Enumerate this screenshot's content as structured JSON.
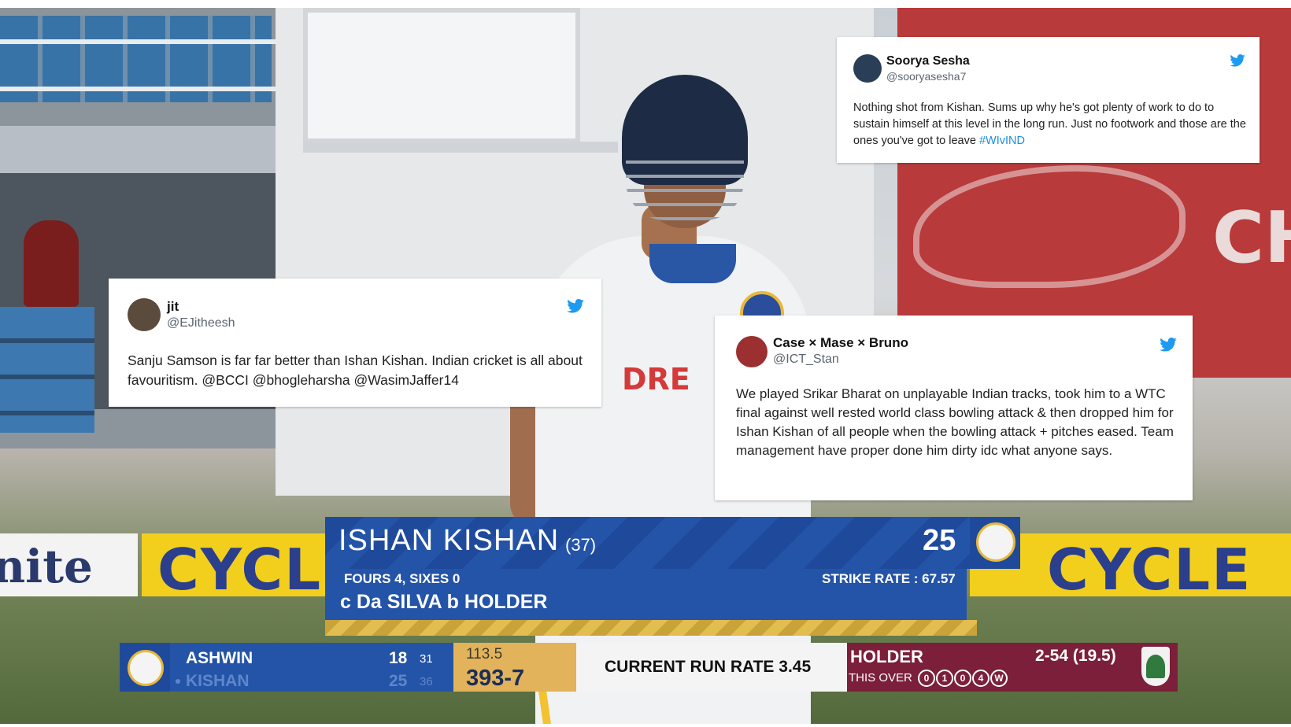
{
  "tweets": [
    {
      "name": "Soorya Sesha",
      "handle": "@sooryasesha7",
      "text": "Nothing shot from Kishan. Sums up why he's got plenty of work to do to sustain himself at this level in the long run. Just no footwork and those are the ones you've got to leave",
      "hashtag": "#WIvIND"
    },
    {
      "name": "jit",
      "handle": "@EJitheesh",
      "text": "Sanju Samson is far far better than Ishan Kishan. Indian cricket is all about favouritism. @BCCI @bhogleharsha @WasimJaffer14"
    },
    {
      "name": "Case × Mase × Bruno",
      "handle": "@ICT_Stan",
      "text": "We played Srikar Bharat on unplayable Indian tracks, took him to a WTC final against well rested world class bowling attack & then dropped him for Ishan Kishan of all people when the bowling attack + pitches eased. Team management have proper done him dirty idc what anyone says."
    }
  ],
  "lower_third": {
    "batter_name": "ISHAN KISHAN",
    "balls": "(37)",
    "runs": "25",
    "boundaries": "FOURS 4, SIXES 0",
    "strike_rate": "STRIKE RATE : 67.57",
    "dismissal": "c Da SILVA  b HOLDER"
  },
  "scorebar": {
    "batter1": {
      "name": "ASHWIN",
      "runs": "18",
      "balls": "31"
    },
    "batter2": {
      "name": "KISHAN",
      "runs": "25",
      "balls": "36"
    },
    "overs": "113.5",
    "score": "393-7",
    "current_run_rate": "CURRENT RUN RATE 3.45",
    "bowler": "HOLDER",
    "bowler_figures": "2-54 (19.5)",
    "this_over_label": "THIS OVER",
    "this_over_balls": [
      "0",
      "1",
      "0",
      "4",
      "W"
    ]
  },
  "scene_text": {
    "sponsor": "DRE",
    "board_left": "nite",
    "board_cycle_1": "CYCL",
    "board_cycle_2": "CYCLE",
    "red_board": "CH"
  },
  "colors": {
    "india_blue": "#2454a8",
    "wi_maroon": "#7b1f3a",
    "twitter_blue": "#1d9bf0",
    "hashtag": "#1d8fdc"
  },
  "icons": [
    "twitter-bird-icon",
    "avatar",
    "india-team-logo",
    "west-indies-team-logo"
  ]
}
